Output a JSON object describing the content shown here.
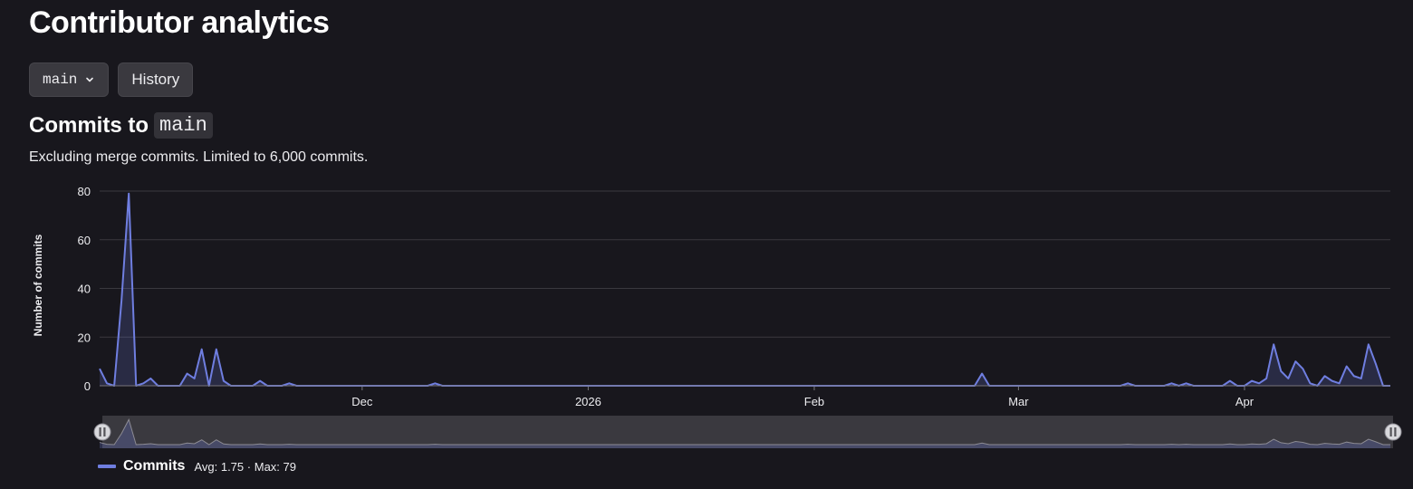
{
  "page": {
    "title": "Contributor analytics"
  },
  "toolbar": {
    "branch_label": "main",
    "history_label": "History"
  },
  "section": {
    "title_prefix": "Commits to",
    "branch": "main",
    "subtitle": "Excluding merge commits. Limited to 6,000 commits."
  },
  "legend": {
    "name": "Commits",
    "avg_label": "Avg: 1.75",
    "separator": "·",
    "max_label": "Max: 79"
  },
  "colors": {
    "series": "#6f7ee0",
    "background": "#18171d",
    "grid": "#3a393f"
  },
  "chart_data": {
    "type": "area",
    "ylabel": "Number of commits",
    "xlabel": "",
    "ylim": [
      0,
      80
    ],
    "yticks": [
      0,
      20,
      40,
      60,
      80
    ],
    "x_range": [
      "2025-10-26",
      "2026-04-21"
    ],
    "xticks": [
      {
        "date": "2025-12-01",
        "label": "Dec"
      },
      {
        "date": "2026-01-01",
        "label": "2026"
      },
      {
        "date": "2026-02-01",
        "label": "Feb"
      },
      {
        "date": "2026-03-01",
        "label": "Mar"
      },
      {
        "date": "2026-04-01",
        "label": "Apr"
      }
    ],
    "grid": true,
    "series": [
      {
        "name": "Commits",
        "points": [
          [
            "2025-10-26",
            7
          ],
          [
            "2025-10-27",
            1
          ],
          [
            "2025-10-29",
            35
          ],
          [
            "2025-10-30",
            79
          ],
          [
            "2025-11-01",
            1
          ],
          [
            "2025-11-02",
            3
          ],
          [
            "2025-11-03",
            0
          ],
          [
            "2025-11-06",
            0
          ],
          [
            "2025-11-07",
            5
          ],
          [
            "2025-11-08",
            3
          ],
          [
            "2025-11-09",
            15
          ],
          [
            "2025-11-11",
            15
          ],
          [
            "2025-11-12",
            2
          ],
          [
            "2025-11-13",
            0
          ],
          [
            "2025-11-16",
            0
          ],
          [
            "2025-11-17",
            2
          ],
          [
            "2025-11-18",
            0
          ],
          [
            "2025-11-20",
            0
          ],
          [
            "2025-11-21",
            1
          ],
          [
            "2025-11-22",
            0
          ],
          [
            "2025-12-10",
            0
          ],
          [
            "2025-12-11",
            1
          ],
          [
            "2025-12-12",
            0
          ],
          [
            "2026-02-23",
            0
          ],
          [
            "2026-02-24",
            5
          ],
          [
            "2026-02-25",
            0
          ],
          [
            "2026-03-15",
            0
          ],
          [
            "2026-03-16",
            1
          ],
          [
            "2026-03-17",
            0
          ],
          [
            "2026-03-21",
            0
          ],
          [
            "2026-03-22",
            1
          ],
          [
            "2026-03-23",
            0
          ],
          [
            "2026-03-24",
            1
          ],
          [
            "2026-03-25",
            0
          ],
          [
            "2026-03-29",
            0
          ],
          [
            "2026-03-30",
            2
          ],
          [
            "2026-03-31",
            0
          ],
          [
            "2026-04-01",
            0
          ],
          [
            "2026-04-02",
            2
          ],
          [
            "2026-04-03",
            1
          ],
          [
            "2026-04-04",
            3
          ],
          [
            "2026-04-05",
            17
          ],
          [
            "2026-04-06",
            6
          ],
          [
            "2026-04-07",
            3
          ],
          [
            "2026-04-08",
            10
          ],
          [
            "2026-04-09",
            7
          ],
          [
            "2026-04-10",
            1
          ],
          [
            "2026-04-11",
            0
          ],
          [
            "2026-04-12",
            4
          ],
          [
            "2026-04-13",
            2
          ],
          [
            "2026-04-14",
            1
          ],
          [
            "2026-04-15",
            8
          ],
          [
            "2026-04-16",
            4
          ],
          [
            "2026-04-17",
            3
          ],
          [
            "2026-04-18",
            17
          ],
          [
            "2026-04-19",
            9
          ]
        ]
      }
    ]
  }
}
